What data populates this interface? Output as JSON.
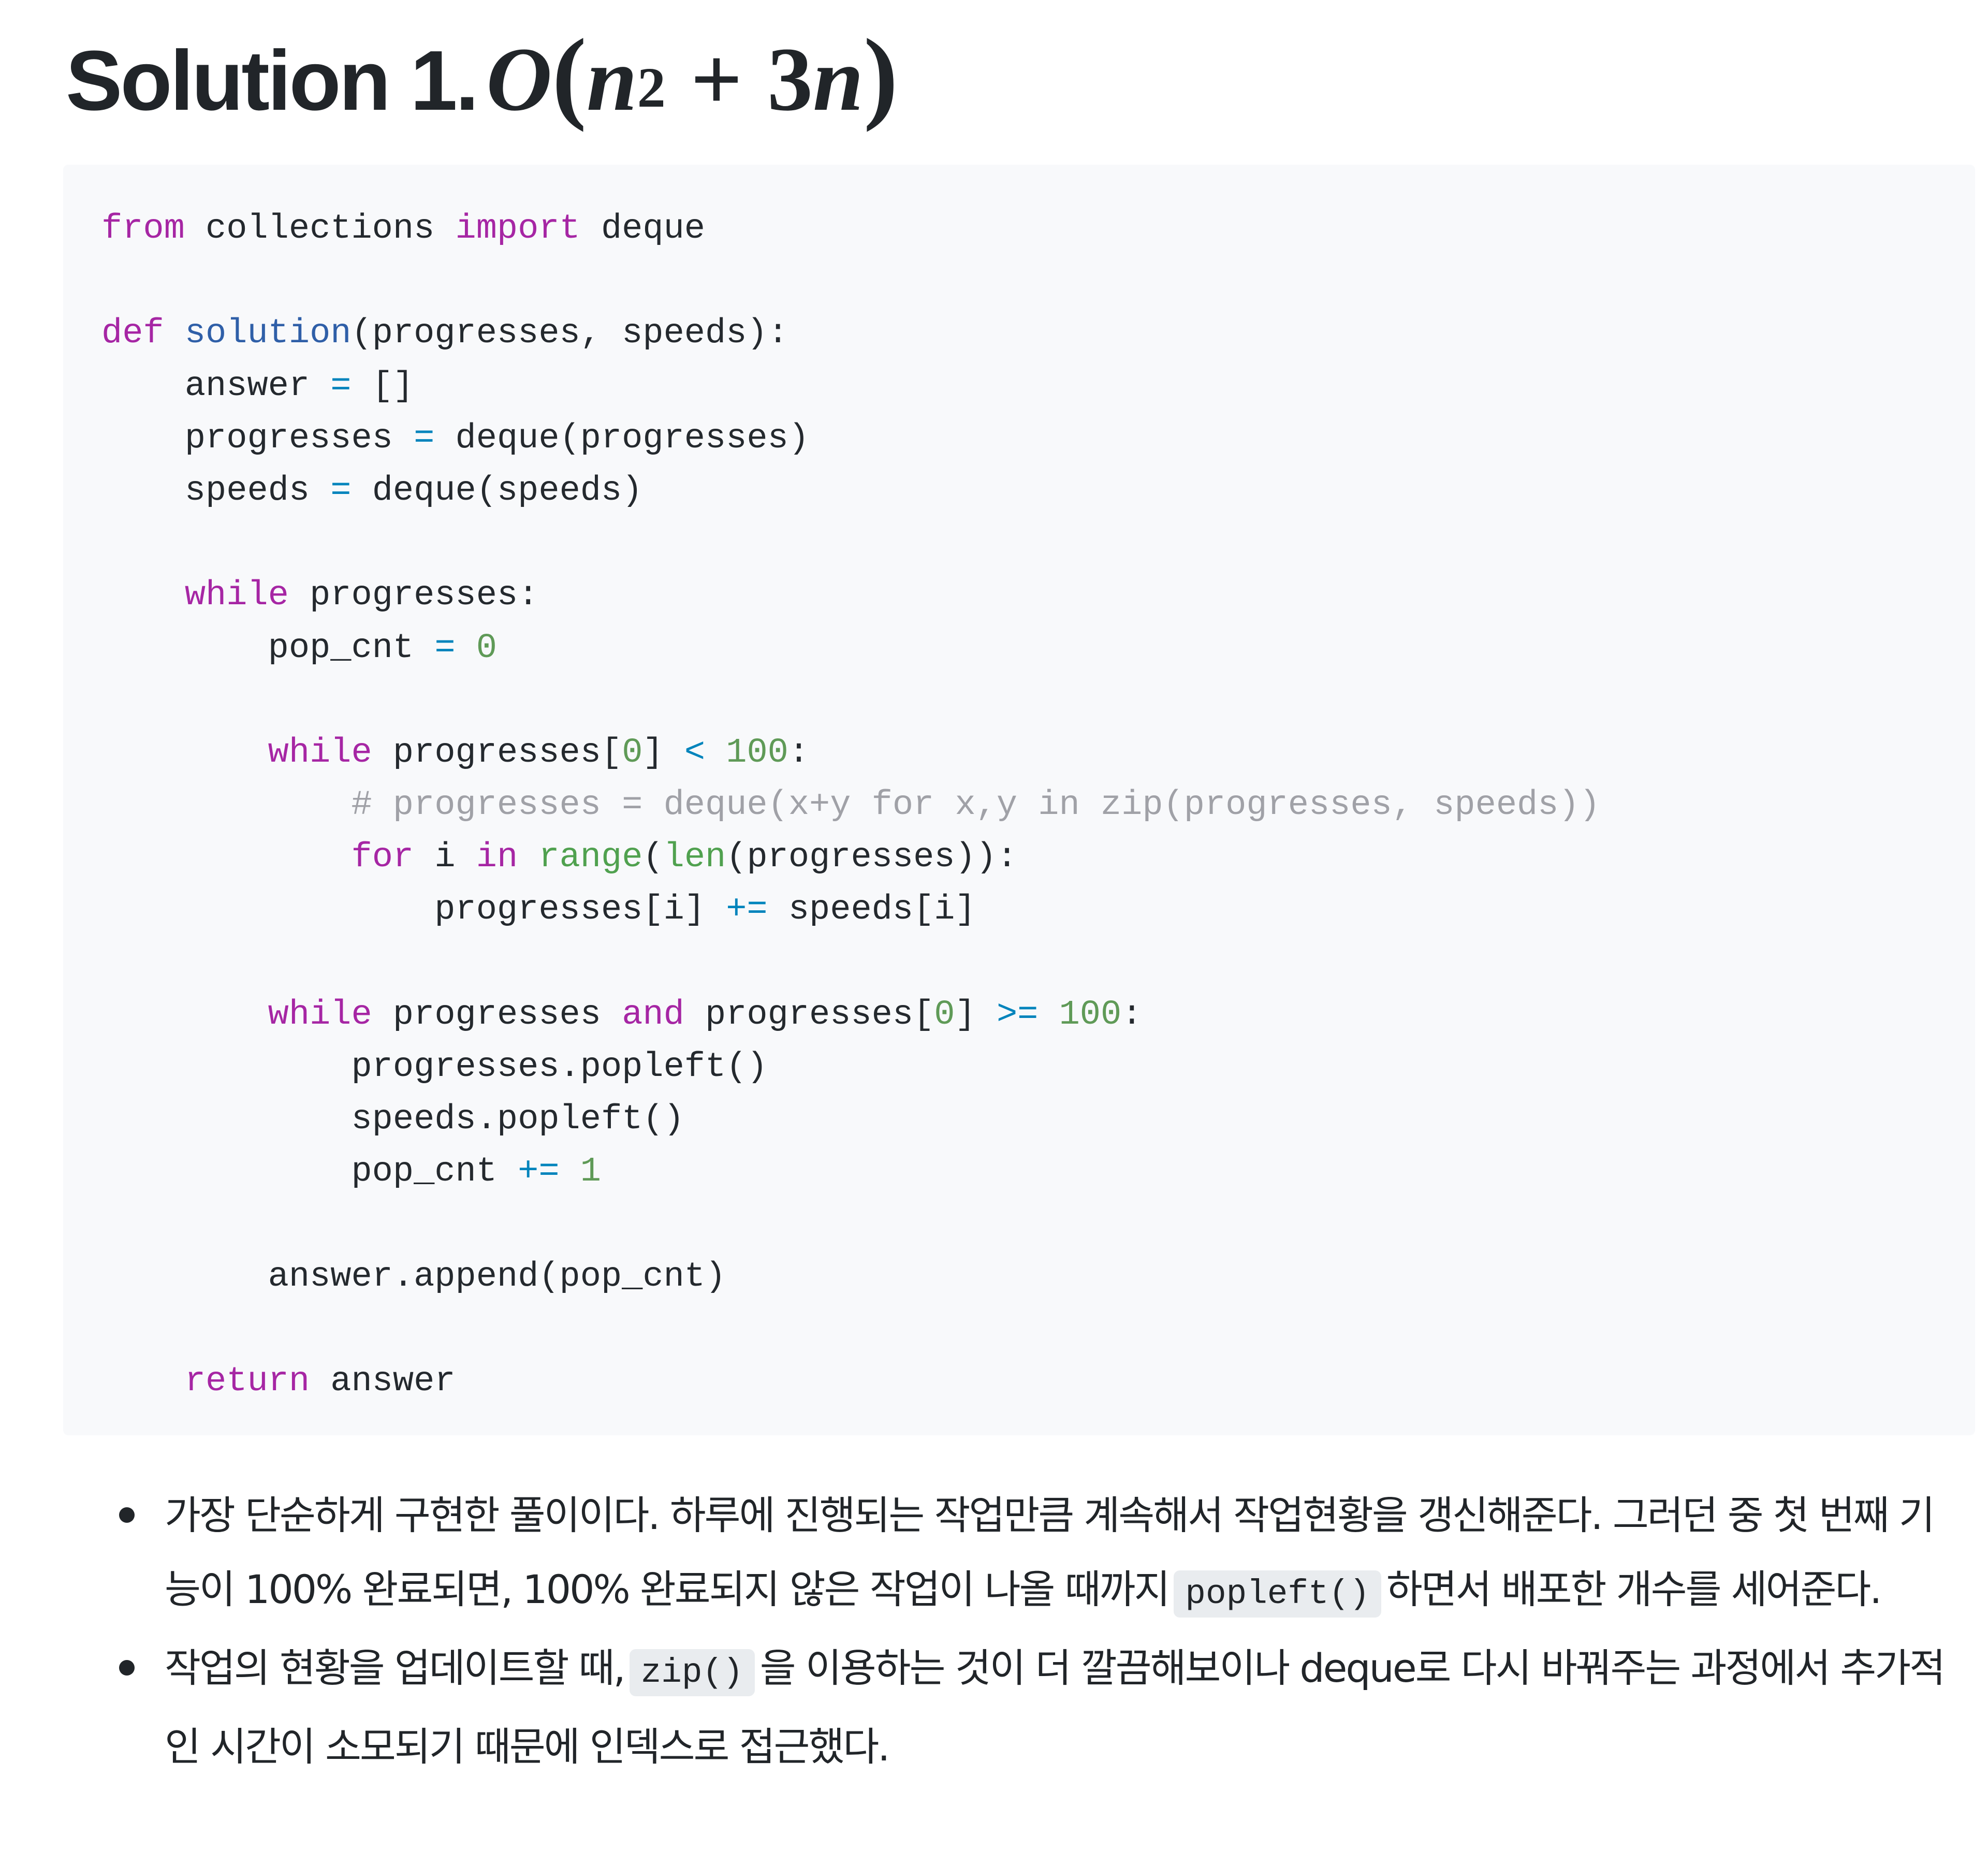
{
  "heading": {
    "label": "Solution 1.",
    "math": {
      "big_o": "O",
      "open_paren": "(",
      "base": "n",
      "exponent": "2",
      "operator": "+",
      "coefficient": "3",
      "term": "n",
      "close_paren": ")"
    }
  },
  "code": {
    "language": "python",
    "lines": [
      [
        {
          "t": "from",
          "k": "keyword"
        },
        {
          "t": " collections ",
          "k": "plain"
        },
        {
          "t": "import",
          "k": "keyword"
        },
        {
          "t": " deque",
          "k": "plain"
        }
      ],
      [],
      [
        {
          "t": "def",
          "k": "keyword"
        },
        {
          "t": " ",
          "k": "plain"
        },
        {
          "t": "solution",
          "k": "func"
        },
        {
          "t": "(progresses, speeds):",
          "k": "plain"
        }
      ],
      [
        {
          "t": "    answer ",
          "k": "plain"
        },
        {
          "t": "=",
          "k": "op"
        },
        {
          "t": " []",
          "k": "plain"
        }
      ],
      [
        {
          "t": "    progresses ",
          "k": "plain"
        },
        {
          "t": "=",
          "k": "op"
        },
        {
          "t": " deque(progresses)",
          "k": "plain"
        }
      ],
      [
        {
          "t": "    speeds ",
          "k": "plain"
        },
        {
          "t": "=",
          "k": "op"
        },
        {
          "t": " deque(speeds)",
          "k": "plain"
        }
      ],
      [],
      [
        {
          "t": "    ",
          "k": "plain"
        },
        {
          "t": "while",
          "k": "keyword"
        },
        {
          "t": " progresses:",
          "k": "plain"
        }
      ],
      [
        {
          "t": "        pop_cnt ",
          "k": "plain"
        },
        {
          "t": "=",
          "k": "op"
        },
        {
          "t": " ",
          "k": "plain"
        },
        {
          "t": "0",
          "k": "number"
        }
      ],
      [],
      [
        {
          "t": "        ",
          "k": "plain"
        },
        {
          "t": "while",
          "k": "keyword"
        },
        {
          "t": " progresses[",
          "k": "plain"
        },
        {
          "t": "0",
          "k": "number"
        },
        {
          "t": "] ",
          "k": "plain"
        },
        {
          "t": "<",
          "k": "op"
        },
        {
          "t": " ",
          "k": "plain"
        },
        {
          "t": "100",
          "k": "number"
        },
        {
          "t": ":",
          "k": "plain"
        }
      ],
      [
        {
          "t": "            ",
          "k": "plain"
        },
        {
          "t": "# progresses = deque(x+y for x,y in zip(progresses, speeds))",
          "k": "comment"
        }
      ],
      [
        {
          "t": "            ",
          "k": "plain"
        },
        {
          "t": "for",
          "k": "keyword"
        },
        {
          "t": " i ",
          "k": "plain"
        },
        {
          "t": "in",
          "k": "keyword"
        },
        {
          "t": " ",
          "k": "plain"
        },
        {
          "t": "range",
          "k": "builtin"
        },
        {
          "t": "(",
          "k": "plain"
        },
        {
          "t": "len",
          "k": "builtin"
        },
        {
          "t": "(progresses)):",
          "k": "plain"
        }
      ],
      [
        {
          "t": "                progresses[i] ",
          "k": "plain"
        },
        {
          "t": "+=",
          "k": "op"
        },
        {
          "t": " speeds[i]",
          "k": "plain"
        }
      ],
      [],
      [
        {
          "t": "        ",
          "k": "plain"
        },
        {
          "t": "while",
          "k": "keyword"
        },
        {
          "t": " progresses ",
          "k": "plain"
        },
        {
          "t": "and",
          "k": "keyword"
        },
        {
          "t": " progresses[",
          "k": "plain"
        },
        {
          "t": "0",
          "k": "number"
        },
        {
          "t": "] ",
          "k": "plain"
        },
        {
          "t": ">=",
          "k": "op"
        },
        {
          "t": " ",
          "k": "plain"
        },
        {
          "t": "100",
          "k": "number"
        },
        {
          "t": ":",
          "k": "plain"
        }
      ],
      [
        {
          "t": "            progresses.popleft()",
          "k": "plain"
        }
      ],
      [
        {
          "t": "            speeds.popleft()",
          "k": "plain"
        }
      ],
      [
        {
          "t": "            pop_cnt ",
          "k": "plain"
        },
        {
          "t": "+=",
          "k": "op"
        },
        {
          "t": " ",
          "k": "plain"
        },
        {
          "t": "1",
          "k": "number"
        }
      ],
      [],
      [
        {
          "t": "        answer.append(pop_cnt)",
          "k": "plain"
        }
      ],
      [],
      [
        {
          "t": "    ",
          "k": "plain"
        },
        {
          "t": "return",
          "k": "keyword"
        },
        {
          "t": " answer",
          "k": "plain"
        }
      ]
    ]
  },
  "bullets": [
    {
      "before": "가장 단순하게 구현한 풀이이다. 하루에 진행되는 작업만큼 계속해서 작업현황을 갱신해준다. 그러던 중 첫 번째 기능이 100% 완료되면, 100% 완료되지 않은 작업이 나올 때까지",
      "code": "popleft()",
      "after": "하면서 배포한 개수를 세어준다."
    },
    {
      "before": "작업의 현황을 업데이트할 때,",
      "code": "zip()",
      "after": "을 이용하는 것이 더 깔끔해보이나 deque로 다시 바꿔주는 과정에서 추가적인 시간이 소모되기 때문에 인덱스로 접근했다."
    }
  ],
  "colors": {
    "text": "#212529",
    "code_background": "#f8f9fb",
    "inline_code_background": "#e9ecef",
    "keyword": "#a626a4",
    "function": "#2f5fa8",
    "builtin": "#50a14f",
    "number": "#5f9a57",
    "operator": "#0184bc",
    "comment": "#a0a1a7"
  }
}
